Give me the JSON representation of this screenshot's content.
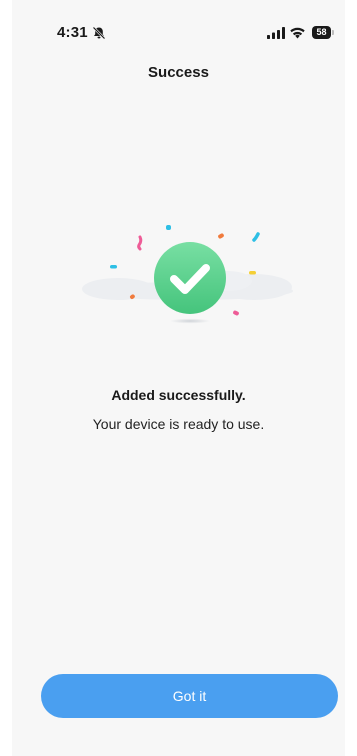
{
  "status_bar": {
    "time": "4:31",
    "battery_level": "58",
    "icons": [
      "bell-slash-icon",
      "cellular-signal-icon",
      "wifi-icon",
      "battery-icon"
    ]
  },
  "header": {
    "title": "Success"
  },
  "illustration": {
    "icon": "checkmark-circle-icon",
    "accent_color": "#5fd490"
  },
  "message": {
    "heading": "Added successfully.",
    "subtext": "Your device is ready to use."
  },
  "actions": {
    "primary_label": "Got it",
    "primary_color": "#4a9ff0"
  }
}
